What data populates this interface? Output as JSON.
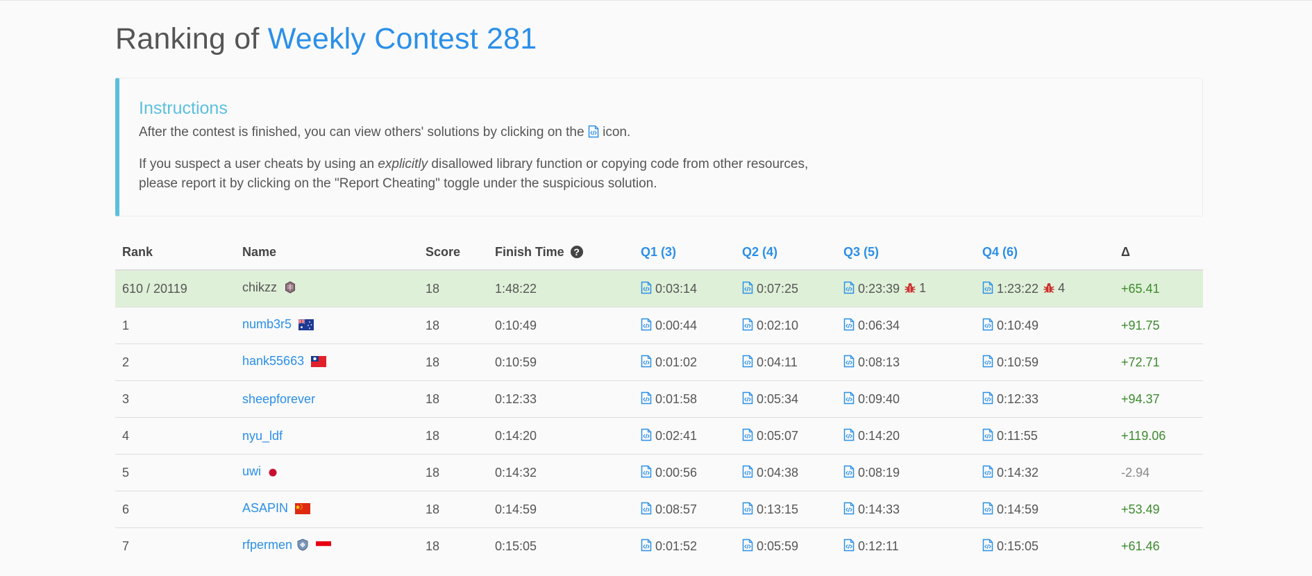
{
  "page": {
    "title_prefix": "Ranking of ",
    "contest_name": "Weekly Contest 281"
  },
  "instructions": {
    "title": "Instructions",
    "line1_before": "After the contest is finished, you can view others' solutions by clicking on the",
    "line1_after": " icon.",
    "line2_before": "If you suspect a user cheats by using an ",
    "line2_em": "explicitly",
    "line2_after": " disallowed library function or copying code from other resources,",
    "line3": "please report it by clicking on the \"Report Cheating\" toggle under the suspicious solution."
  },
  "table": {
    "headers": {
      "rank": "Rank",
      "name": "Name",
      "score": "Score",
      "finish_time": "Finish Time",
      "q1": "Q1 (3)",
      "q2": "Q2 (4)",
      "q3": "Q3 (5)",
      "q4": "Q4 (6)",
      "delta": "Δ"
    },
    "self_row": {
      "rank": "610 / 20119",
      "name": "chikzz",
      "badge": "guardian-badge-icon",
      "score": "18",
      "finish": "1:48:22",
      "q1": "0:03:14",
      "q2": "0:07:25",
      "q3": "0:23:39",
      "q3_bugs": "1",
      "q4": "1:23:22",
      "q4_bugs": "4",
      "delta": "+65.41"
    },
    "rows": [
      {
        "rank": "1",
        "name": "numb3r5",
        "flag": "australia-flag-icon",
        "score": "18",
        "finish": "0:10:49",
        "q1": "0:00:44",
        "q2": "0:02:10",
        "q3": "0:06:34",
        "q4": "0:10:49",
        "delta": "+91.75"
      },
      {
        "rank": "2",
        "name": "hank55663",
        "flag": "taiwan-flag-icon",
        "score": "18",
        "finish": "0:10:59",
        "q1": "0:01:02",
        "q2": "0:04:11",
        "q3": "0:08:13",
        "q4": "0:10:59",
        "delta": "+72.71"
      },
      {
        "rank": "3",
        "name": "sheepforever",
        "flag": "",
        "score": "18",
        "finish": "0:12:33",
        "q1": "0:01:58",
        "q2": "0:05:34",
        "q3": "0:09:40",
        "q4": "0:12:33",
        "delta": "+94.37"
      },
      {
        "rank": "4",
        "name": "nyu_ldf",
        "flag": "",
        "score": "18",
        "finish": "0:14:20",
        "q1": "0:02:41",
        "q2": "0:05:07",
        "q3": "0:14:20",
        "q4": "0:11:55",
        "delta": "+119.06"
      },
      {
        "rank": "5",
        "name": "uwi",
        "flag": "japan-flag-icon",
        "score": "18",
        "finish": "0:14:32",
        "q1": "0:00:56",
        "q2": "0:04:38",
        "q3": "0:08:19",
        "q4": "0:14:32",
        "delta": "-2.94"
      },
      {
        "rank": "6",
        "name": "ASAPIN",
        "flag": "china-flag-icon",
        "score": "18",
        "finish": "0:14:59",
        "q1": "0:08:57",
        "q2": "0:13:15",
        "q3": "0:14:33",
        "q4": "0:14:59",
        "delta": "+53.49"
      },
      {
        "rank": "7",
        "name": "rfpermen",
        "flag": "indonesia-flag-icon",
        "badge": "knight-badge-icon",
        "score": "18",
        "finish": "0:15:05",
        "q1": "0:01:52",
        "q2": "0:05:59",
        "q3": "0:12:11",
        "q4": "0:15:05",
        "delta": "+61.46"
      }
    ]
  },
  "colors": {
    "accent": "#2b8fe8",
    "info": "#5bc0de",
    "self_row_bg": "#dff0d8",
    "positive": "#3c8a2e",
    "bug": "#c9302c"
  }
}
